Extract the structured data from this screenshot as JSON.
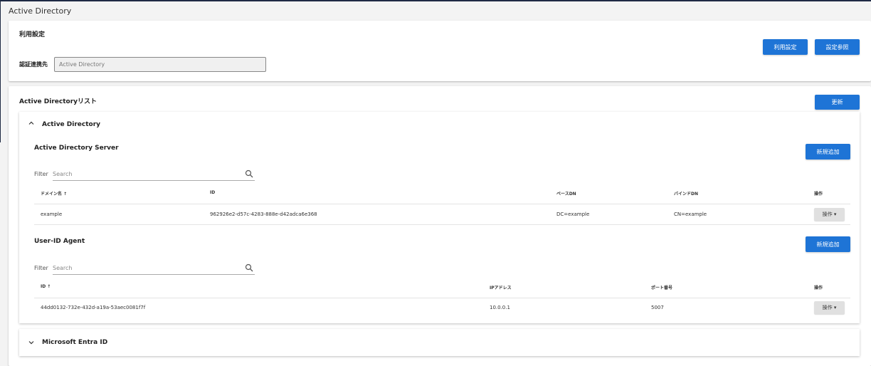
{
  "page": {
    "title": "Active Directory"
  },
  "usage": {
    "title": "利用設定",
    "auth_label": "認証連携先",
    "auth_value": "Active Directory",
    "btn_usage": "利用設定",
    "btn_ref": "設定参照"
  },
  "ad_list": {
    "title": "Active Directoryリスト",
    "btn_update": "更新",
    "ad_section": {
      "header": "Active Directory",
      "server": {
        "title": "Active Directory Server",
        "btn_add": "新規追加",
        "filter_label": "Filter",
        "filter_placeholder": "Search",
        "columns": [
          "ドメイン名 ↑",
          "ID",
          "ベースDN",
          "バインドDN",
          "操作"
        ],
        "rows": [
          {
            "domain": "example",
            "id": "962926e2-d57c-4283-888e-d42adca6e368",
            "base_dn": "DC=example",
            "bind_dn": "CN=example",
            "op": "操作 ▾"
          }
        ]
      },
      "agent": {
        "title": "User-ID Agent",
        "btn_add": "新規追加",
        "filter_label": "Filter",
        "filter_placeholder": "Search",
        "columns": [
          "ID ↑",
          "IPアドレス",
          "ポート番号",
          "操作"
        ],
        "rows": [
          {
            "id": "44dd0132-732e-432d-a19a-53aec0081f7f",
            "ip": "10.0.0.1",
            "port": "5007",
            "op": "操作 ▾"
          }
        ]
      }
    },
    "entra_section": {
      "header": "Microsoft Entra ID"
    }
  }
}
